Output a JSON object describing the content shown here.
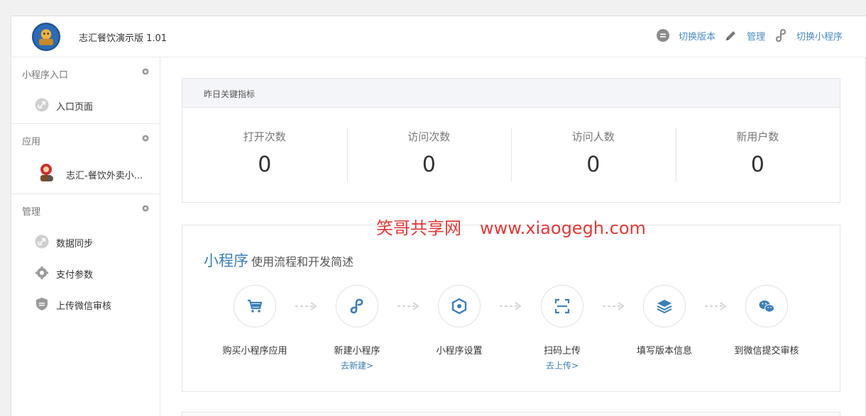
{
  "header": {
    "app_title": "志汇餐饮演示版 1.01",
    "actions": [
      {
        "label": "切换版本",
        "icon": "switch-version-icon"
      },
      {
        "label": "管理",
        "icon": "pencil-icon"
      },
      {
        "label": "切换小程序",
        "icon": "link-icon"
      }
    ]
  },
  "sidebar": {
    "sections": [
      {
        "title": "小程序入口",
        "items": [
          {
            "label": "入口页面",
            "icon": "link-icon"
          }
        ]
      },
      {
        "title": "应用",
        "items": [
          {
            "label": "志汇-餐饮外卖小...",
            "icon": "app-avatar-icon"
          }
        ]
      },
      {
        "title": "管理",
        "items": [
          {
            "label": "数据同步",
            "icon": "link-icon"
          },
          {
            "label": "支付参数",
            "icon": "gear-icon"
          },
          {
            "label": "上传微信审核",
            "icon": "shield-icon"
          }
        ]
      }
    ]
  },
  "kpi": {
    "title": "昨日关键指标",
    "metrics": [
      {
        "label": "打开次数",
        "value": "0"
      },
      {
        "label": "访问次数",
        "value": "0"
      },
      {
        "label": "访问人数",
        "value": "0"
      },
      {
        "label": "新用户数",
        "value": "0"
      }
    ]
  },
  "watermark": {
    "text": "笑哥共享网",
    "url": "www.xiaogegh.com"
  },
  "flow": {
    "title": "小程序",
    "subtitle": "使用流程和开发简述",
    "steps": [
      {
        "label": "购买小程序应用",
        "icon": "cart-icon",
        "link": ""
      },
      {
        "label": "新建小程序",
        "icon": "mini-program-icon",
        "link": "去新建>"
      },
      {
        "label": "小程序设置",
        "icon": "settings-hexagon-icon",
        "link": ""
      },
      {
        "label": "扫码上传",
        "icon": "scan-icon",
        "link": "去上传>"
      },
      {
        "label": "填写版本信息",
        "icon": "layers-icon",
        "link": ""
      },
      {
        "label": "到微信提交审核",
        "icon": "wechat-icon",
        "link": ""
      }
    ]
  },
  "colors": {
    "accent": "#3c7fb6",
    "watermark": "#e03a3a"
  }
}
